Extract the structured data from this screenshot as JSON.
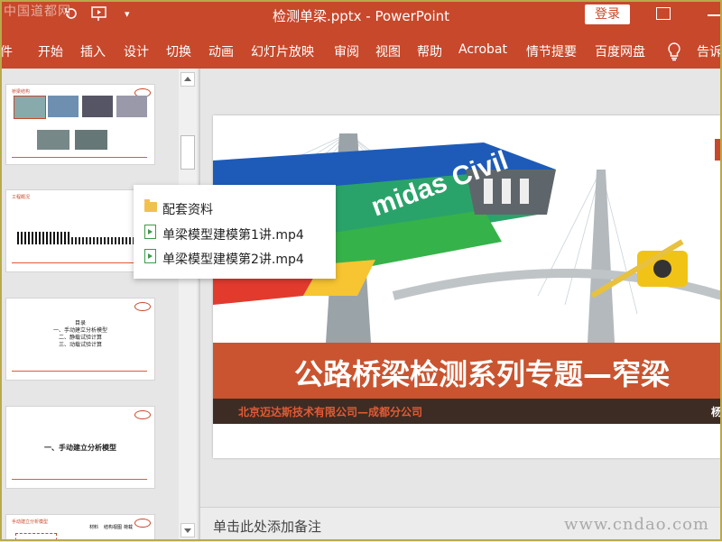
{
  "titlebar": {
    "watermark": "中国道都网",
    "doc_title": "检测单梁.pptx - PowerPoint",
    "login_label": "登录"
  },
  "ribbon": {
    "tabs": [
      "件",
      "开始",
      "插入",
      "设计",
      "切换",
      "动画",
      "幻灯片放映",
      "审阅",
      "视图",
      "帮助",
      "Acrobat",
      "情节提要",
      "百度网盘",
      "告诉"
    ]
  },
  "thumbnails": [
    {
      "header": "桥梁结构",
      "number": ""
    },
    {
      "header": "工程概况",
      "number": ""
    },
    {
      "header": "",
      "lines": [
        "目录",
        "一、手动建立分析模型",
        "二、静载试验计算",
        "三、动载试验计算"
      ]
    },
    {
      "header": "",
      "title": "一、手动建立分析模型"
    },
    {
      "header": "手动建立分析模型",
      "cols": [
        "材料",
        "结构视图",
        "荷载"
      ]
    }
  ],
  "popup": {
    "items": [
      {
        "icon": "folder-icon",
        "label": "配套资料"
      },
      {
        "icon": "video-file-icon",
        "label": "单梁模型建模第1讲.mp4"
      },
      {
        "icon": "video-file-icon",
        "label": "单梁模型建模第2讲.mp4"
      }
    ]
  },
  "slide": {
    "brand": "midas Civil",
    "title": "公路桥梁检测系列专题—窄梁",
    "subtitle": "北京迈达斯技术有限公司—成都分公司",
    "subtitle_right": "杨"
  },
  "notes": {
    "placeholder": "单击此处添加备注",
    "watermark": "www.cndao.com"
  }
}
